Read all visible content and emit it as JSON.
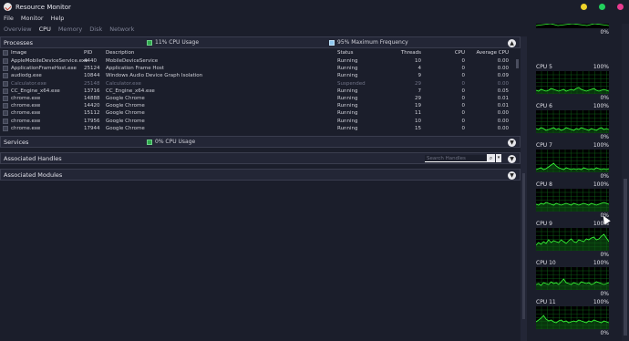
{
  "window": {
    "title": "Resource Monitor"
  },
  "colors": {
    "close": "#e83b8f",
    "maximize": "#22d15c",
    "minimize": "#f0d32a",
    "cpu_usage": "#2ea84a",
    "max_freq": "#8fc7ee"
  },
  "menu": [
    "File",
    "Monitor",
    "Help"
  ],
  "tabs": [
    "Overview",
    "CPU",
    "Memory",
    "Disk",
    "Network"
  ],
  "processes": {
    "title": "Processes",
    "cpu_usage_legend": "11% CPU Usage",
    "max_freq_legend": "95% Maximum Frequency",
    "columns": {
      "image": "Image",
      "pid": "PID",
      "description": "Description",
      "status": "Status",
      "threads": "Threads",
      "cpu": "CPU",
      "avg_cpu": "Average CPU"
    },
    "rows": [
      {
        "image": "AppleMobileDeviceService.exe",
        "pid": "4440",
        "description": "MobileDeviceService",
        "status": "Running",
        "threads": "10",
        "cpu": "0",
        "avg_cpu": "0.00"
      },
      {
        "image": "ApplicationFrameHost.exe",
        "pid": "25124",
        "description": "Application Frame Host",
        "status": "Running",
        "threads": "4",
        "cpu": "0",
        "avg_cpu": "0.00"
      },
      {
        "image": "audiodg.exe",
        "pid": "10844",
        "description": "Windows Audio Device Graph Isolation",
        "status": "Running",
        "threads": "9",
        "cpu": "0",
        "avg_cpu": "0.09"
      },
      {
        "image": "Calculator.exe",
        "pid": "25148",
        "description": "Calculator.exe",
        "status": "Suspended",
        "threads": "29",
        "cpu": "0",
        "avg_cpu": "0.00"
      },
      {
        "image": "CC_Engine_x64.exe",
        "pid": "13716",
        "description": "CC_Engine_x64.exe",
        "status": "Running",
        "threads": "7",
        "cpu": "0",
        "avg_cpu": "0.05"
      },
      {
        "image": "chrome.exe",
        "pid": "14888",
        "description": "Google Chrome",
        "status": "Running",
        "threads": "29",
        "cpu": "0",
        "avg_cpu": "0.01"
      },
      {
        "image": "chrome.exe",
        "pid": "14420",
        "description": "Google Chrome",
        "status": "Running",
        "threads": "19",
        "cpu": "0",
        "avg_cpu": "0.01"
      },
      {
        "image": "chrome.exe",
        "pid": "15112",
        "description": "Google Chrome",
        "status": "Running",
        "threads": "11",
        "cpu": "0",
        "avg_cpu": "0.00"
      },
      {
        "image": "chrome.exe",
        "pid": "17956",
        "description": "Google Chrome",
        "status": "Running",
        "threads": "10",
        "cpu": "0",
        "avg_cpu": "0.00"
      },
      {
        "image": "chrome.exe",
        "pid": "17944",
        "description": "Google Chrome",
        "status": "Running",
        "threads": "15",
        "cpu": "0",
        "avg_cpu": "0.00"
      }
    ]
  },
  "services": {
    "title": "Services",
    "cpu_usage_legend": "0% CPU Usage"
  },
  "handles": {
    "title": "Associated Handles",
    "search_placeholder": "Search Handles"
  },
  "modules": {
    "title": "Associated Modules"
  },
  "cpu_graphs": {
    "top_partial": {
      "pct_bottom": "0%"
    },
    "cores": [
      {
        "label": "CPU 5",
        "max": "100%",
        "min": "0%",
        "profile": [
          4,
          3,
          5,
          4,
          3,
          4,
          6,
          5,
          4,
          3,
          4,
          5,
          3,
          4,
          5,
          4,
          6,
          7,
          5,
          4,
          3,
          4,
          5,
          6,
          4,
          3,
          4,
          5,
          4,
          3
        ]
      },
      {
        "label": "CPU 6",
        "max": "100%",
        "min": "0%",
        "profile": [
          5,
          4,
          6,
          5,
          3,
          4,
          5,
          6,
          4,
          5,
          3,
          4,
          6,
          5,
          4,
          3,
          5,
          4,
          6,
          5,
          4,
          3,
          5,
          4,
          3,
          5,
          6,
          4,
          5,
          4
        ]
      },
      {
        "label": "CPU 7",
        "max": "100%",
        "min": "0%",
        "profile": [
          3,
          4,
          5,
          3,
          4,
          6,
          8,
          10,
          7,
          5,
          4,
          3,
          5,
          4,
          3,
          4,
          3,
          4,
          3,
          5,
          4,
          3,
          4,
          3,
          5,
          4,
          3,
          4,
          3,
          4
        ]
      },
      {
        "label": "CPU 8",
        "max": "100%",
        "min": "0%",
        "profile": [
          8,
          7,
          9,
          8,
          10,
          9,
          8,
          7,
          9,
          8,
          7,
          8,
          9,
          8,
          7,
          9,
          8,
          7,
          8,
          9,
          8,
          7,
          9,
          8,
          7,
          8,
          9,
          10,
          9,
          8
        ]
      },
      {
        "label": "CPU 9",
        "max": "100%",
        "min": "0%",
        "profile": [
          6,
          9,
          7,
          10,
          8,
          12,
          9,
          11,
          10,
          9,
          12,
          10,
          8,
          11,
          13,
          10,
          9,
          12,
          11,
          10,
          13,
          12,
          14,
          15,
          12,
          13,
          16,
          18,
          14,
          10
        ]
      },
      {
        "label": "CPU 10",
        "max": "100%",
        "min": "0%",
        "profile": [
          6,
          7,
          5,
          8,
          7,
          6,
          9,
          7,
          8,
          6,
          9,
          12,
          8,
          7,
          6,
          8,
          7,
          6,
          9,
          8,
          7,
          8,
          6,
          7,
          9,
          8,
          7,
          6,
          7,
          8
        ]
      },
      {
        "label": "CPU 11",
        "max": "100%",
        "min": "0%",
        "profile": [
          8,
          10,
          12,
          15,
          11,
          9,
          10,
          8,
          7,
          9,
          10,
          8,
          9,
          7,
          8,
          9,
          8,
          10,
          9,
          8,
          7,
          9,
          8,
          10,
          9,
          8,
          7,
          9,
          8,
          7
        ]
      }
    ]
  }
}
